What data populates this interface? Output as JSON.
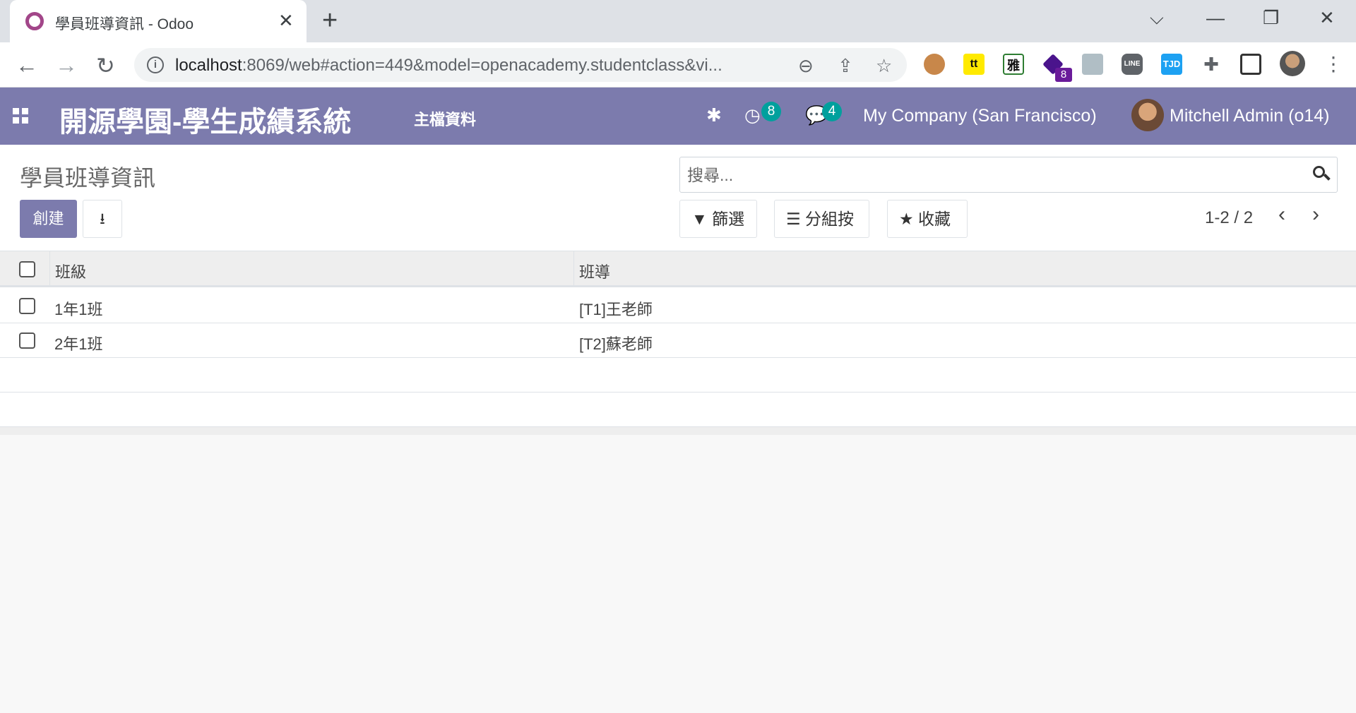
{
  "browser": {
    "tab_title": "學員班導資訊 - Odoo",
    "url_host": "localhost",
    "url_rest": ":8069/web#action=449&model=openacademy.studentclass&vi...",
    "ext_badge": "8"
  },
  "navbar": {
    "brand": "開源學園-學生成績系統",
    "menu_master_data": "主檔資料",
    "activity_count": "8",
    "messages_count": "4",
    "company": "My Company (San Francisco)",
    "user": "Mitchell Admin (o14)"
  },
  "control_panel": {
    "breadcrumb": "學員班導資訊",
    "create_label": "創建",
    "search_placeholder": "搜尋...",
    "filter_label": "篩選",
    "groupby_label": "分組按",
    "favorites_label": "收藏",
    "pager": "1-2 / 2"
  },
  "list": {
    "columns": [
      "班級",
      "班導"
    ],
    "rows": [
      {
        "class": "1年1班",
        "teacher": "[T1]王老師"
      },
      {
        "class": "2年1班",
        "teacher": "[T2]蘇老師"
      }
    ]
  },
  "colors": {
    "odoo_primary": "#7c7bad",
    "badge": "#00a09d"
  }
}
